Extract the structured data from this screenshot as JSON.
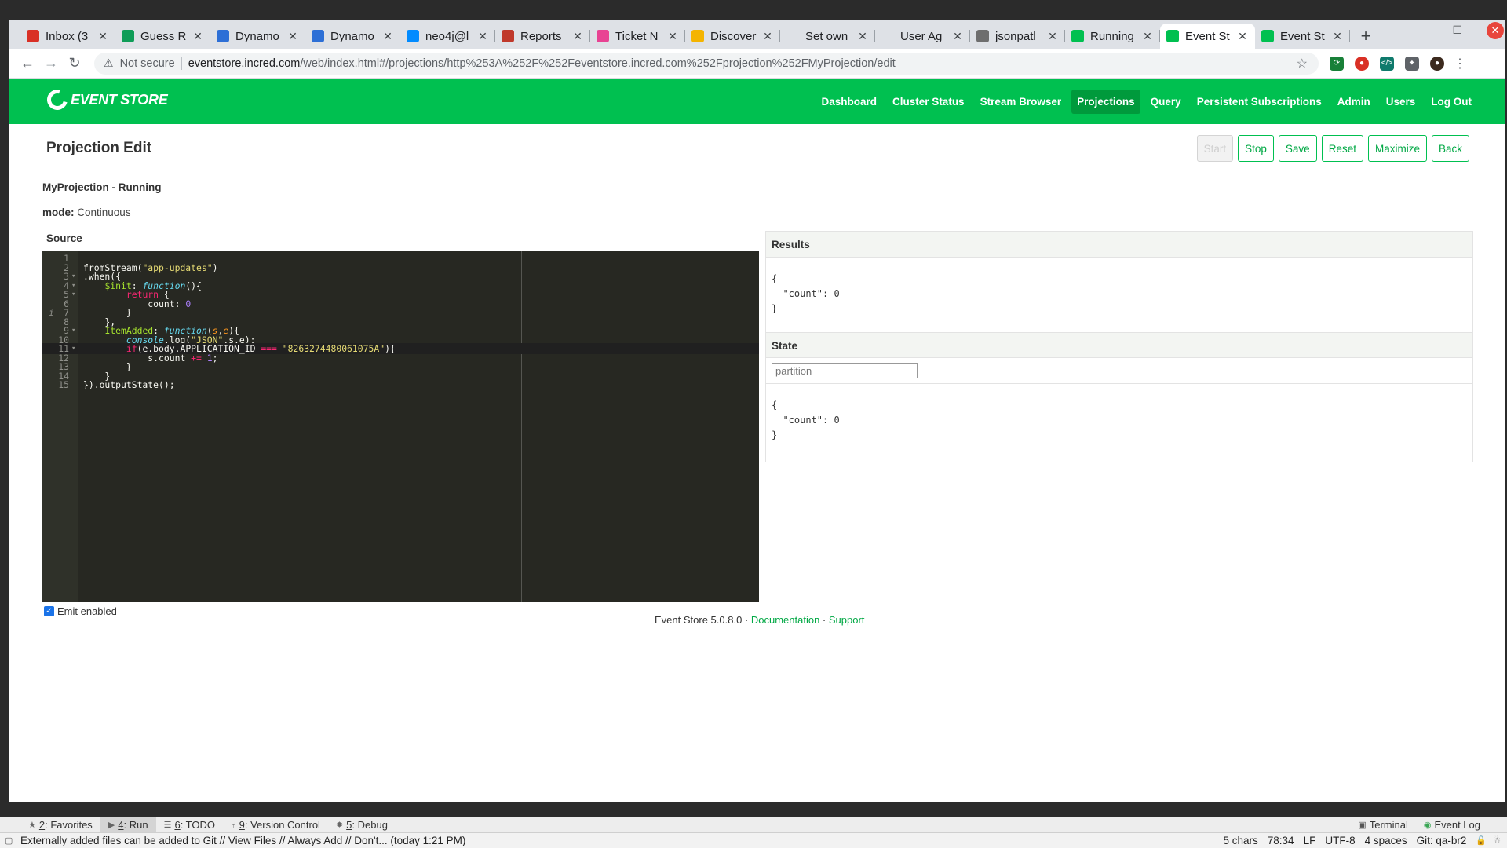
{
  "browser": {
    "tabs": [
      {
        "label": "Inbox (3",
        "icon": "gmail-icon",
        "color": "#d93025"
      },
      {
        "label": "Guess R",
        "icon": "sheets-icon",
        "color": "#0f9d58"
      },
      {
        "label": "Dynamo",
        "icon": "dynamodb-icon",
        "color": "#2d6fd6"
      },
      {
        "label": "Dynamo",
        "icon": "dynamodb-icon",
        "color": "#2d6fd6"
      },
      {
        "label": "neo4j@l",
        "icon": "neo4j-icon",
        "color": "#018bff"
      },
      {
        "label": "Reports",
        "icon": "reports-icon",
        "color": "#c0392b"
      },
      {
        "label": "Ticket N",
        "icon": "ticket-icon",
        "color": "#e84393"
      },
      {
        "label": "Discover",
        "icon": "discover-icon",
        "color": "#f4b400"
      },
      {
        "label": "Set own",
        "icon": "blank-icon",
        "color": "#dee1e6"
      },
      {
        "label": "User Ag",
        "icon": "blank-icon",
        "color": "#dee1e6"
      },
      {
        "label": "jsonpatl",
        "icon": "github-icon",
        "color": "#6e6e6e"
      },
      {
        "label": "Running",
        "icon": "eventstore-icon",
        "color": "#00c050"
      },
      {
        "label": "Event St",
        "icon": "eventstore-icon",
        "color": "#00c050",
        "active": true
      },
      {
        "label": "Event St",
        "icon": "eventstore-icon",
        "color": "#00c050"
      }
    ],
    "security_label": "Not secure",
    "url_host": "eventstore.incred.com",
    "url_path": "/web/index.html#/projections/http%253A%252F%252Feventstore.incred.com%252Fprojection%252FMyProjection/edit"
  },
  "app": {
    "brand": "EVENT STORE",
    "nav": [
      {
        "label": "Dashboard"
      },
      {
        "label": "Cluster Status"
      },
      {
        "label": "Stream Browser"
      },
      {
        "label": "Projections",
        "active": true
      },
      {
        "label": "Query"
      },
      {
        "label": "Persistent Subscriptions"
      },
      {
        "label": "Admin"
      },
      {
        "label": "Users"
      },
      {
        "label": "Log Out"
      }
    ],
    "accent": "#00c050"
  },
  "page": {
    "title": "Projection Edit",
    "buttons": {
      "start": "Start",
      "stop": "Stop",
      "save": "Save",
      "reset": "Reset",
      "maximize": "Maximize",
      "back": "Back"
    },
    "projection_status": "MyProjection - Running",
    "mode_label": "mode:",
    "mode_value": "Continuous",
    "source_label": "Source",
    "emit_label": "Emit enabled",
    "emit_checked": true
  },
  "editor": {
    "lines": [
      "",
      "fromStream(\"app-updates\")",
      ".when({",
      "    $init: function(){",
      "        return {",
      "            count: 0",
      "        }",
      "    },",
      "    ItemAdded: function(s,e){",
      "        console.log(\"JSON\",s,e);",
      "        if(e.body.APPLICATION_ID === \"8263274480061075A\"){",
      "            s.count += 1;",
      "        }",
      "    }",
      "}).outputState();"
    ],
    "current_line": 11
  },
  "results": {
    "title": "Results",
    "json": [
      "{",
      "  \"count\": 0",
      "}"
    ]
  },
  "state": {
    "title": "State",
    "partition_placeholder": "partition",
    "json": [
      "{",
      "  \"count\": 0",
      "}"
    ]
  },
  "footer": {
    "version": "Event Store 5.0.8.0 · ",
    "documentation": "Documentation",
    "dot": " · ",
    "support": "Support"
  },
  "ide": {
    "tools": [
      {
        "num": "2",
        "label": ": Favorites",
        "icon": "star-icon"
      },
      {
        "num": "4",
        "label": ": Run",
        "icon": "run-icon",
        "selected": true
      },
      {
        "num": "6",
        "label": ": TODO",
        "icon": "todo-icon"
      },
      {
        "num": "9",
        "label": ": Version Control",
        "icon": "vcs-icon"
      },
      {
        "num": "5",
        "label": ": Debug",
        "icon": "debug-icon"
      }
    ],
    "right_tools": [
      {
        "label": "Terminal",
        "icon": "terminal-icon"
      },
      {
        "label": "Event Log",
        "icon": "event-log-icon"
      }
    ],
    "status_message": "Externally added files can be added to Git // View Files // Always Add // Don't... (today 1:21 PM)",
    "status_items": [
      "5 chars",
      "78:34",
      "LF",
      "UTF-8",
      "4 spaces",
      "Git: qa-br2"
    ]
  }
}
